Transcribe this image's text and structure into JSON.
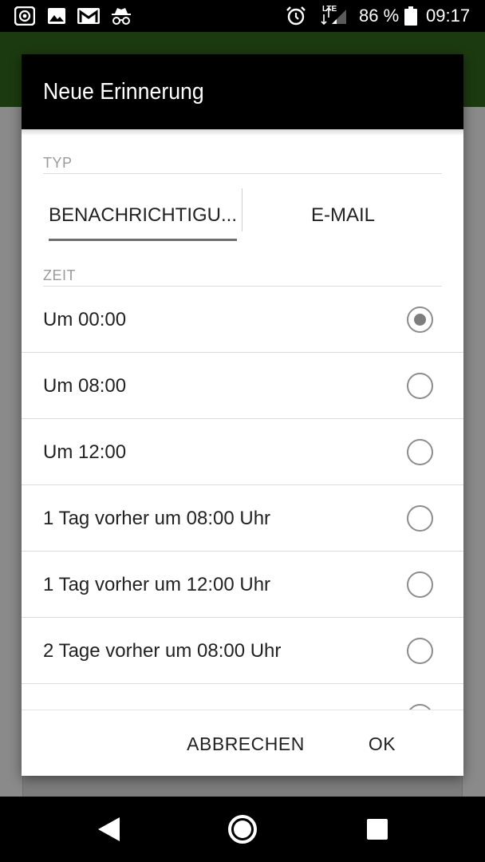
{
  "status_bar": {
    "battery_percent": "86 %",
    "time": "09:17",
    "network": "LTE",
    "icons": [
      "screen-record-icon",
      "image-icon",
      "gmail-icon",
      "incognito-icon",
      "alarm-icon",
      "signal-icon",
      "battery-icon"
    ]
  },
  "dialog": {
    "title": "Neue Erinnerung",
    "type_section_label": "TYP",
    "tabs": [
      {
        "label": "BENACHRICHTIGU...",
        "selected": true
      },
      {
        "label": "E-MAIL",
        "selected": false
      }
    ],
    "time_section_label": "ZEIT",
    "options": [
      {
        "label": "Um 00:00",
        "selected": true
      },
      {
        "label": "Um 08:00",
        "selected": false
      },
      {
        "label": "Um 12:00",
        "selected": false
      },
      {
        "label": "1 Tag vorher um 08:00 Uhr",
        "selected": false
      },
      {
        "label": "1 Tag vorher um 12:00 Uhr",
        "selected": false
      },
      {
        "label": "2 Tage vorher um 08:00 Uhr",
        "selected": false
      }
    ],
    "cancel_label": "ABBRECHEN",
    "ok_label": "OK"
  },
  "nav_bar": {
    "icons": [
      "back-icon",
      "home-icon",
      "recents-icon"
    ]
  },
  "colors": {
    "app_bar": "#1c3a10",
    "dialog_header": "#000000",
    "scrim": "#8a8a8a",
    "radio": "#7e7e7e"
  }
}
